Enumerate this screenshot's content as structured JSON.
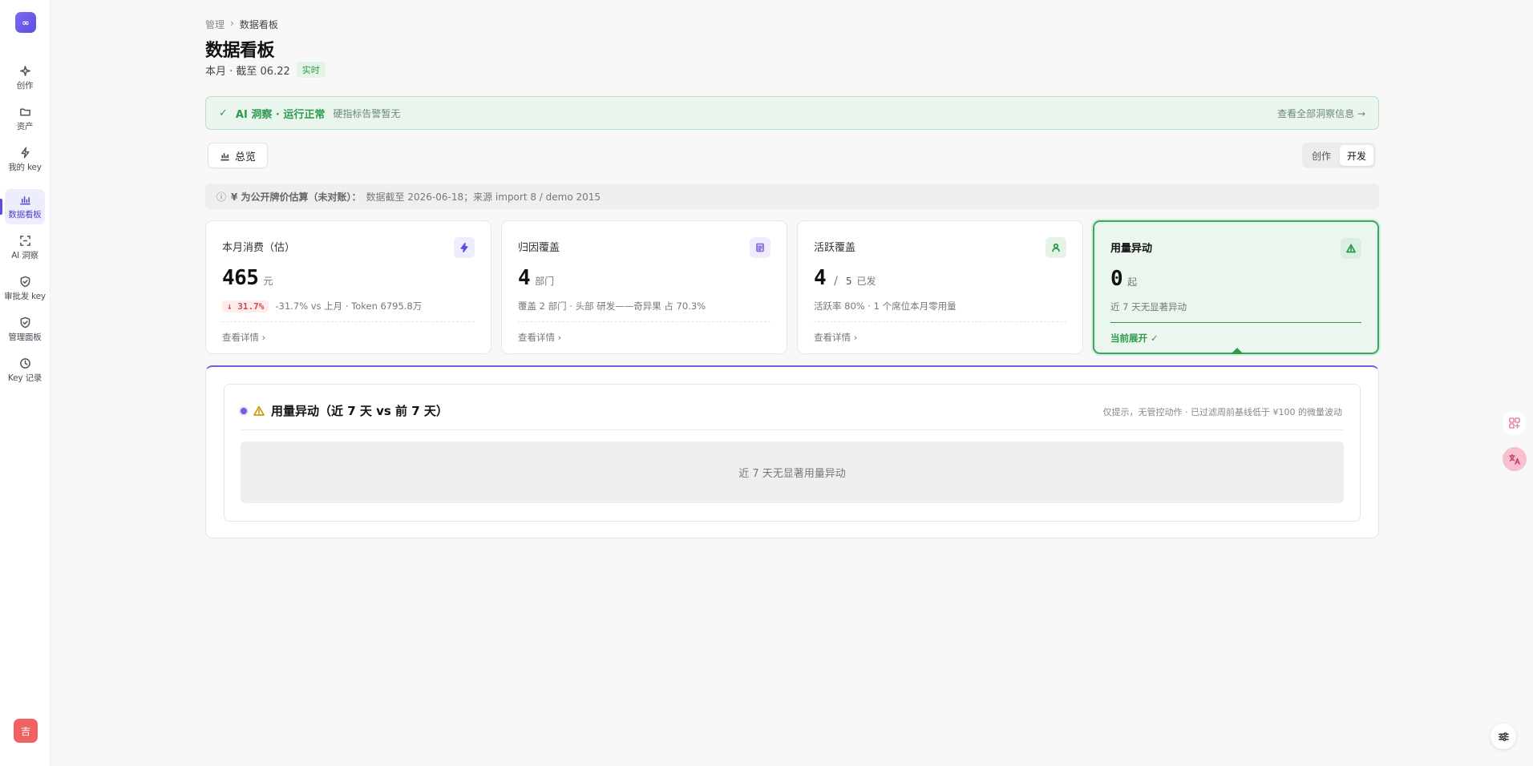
{
  "app": {
    "logo_text": "∞",
    "avatar_text": "吉"
  },
  "sidebar": {
    "items": [
      {
        "label": "创作",
        "icon": "sparkle-icon"
      },
      {
        "label": "资产",
        "icon": "folder-icon"
      },
      {
        "label": "我的 key",
        "icon": "lightning-icon"
      },
      {
        "label": "数据看板",
        "icon": "chart-icon",
        "active": true
      },
      {
        "label": "AI 洞察",
        "icon": "scan-icon"
      },
      {
        "label": "审批发 key",
        "icon": "shield-icon"
      },
      {
        "label": "管理面板",
        "icon": "shield-check-icon"
      },
      {
        "label": "Key 记录",
        "icon": "clock-icon"
      }
    ]
  },
  "breadcrumb": {
    "parent": "管理",
    "separator": "›",
    "current": "数据看板"
  },
  "header": {
    "title": "数据看板",
    "subtitle": "本月 · 截至 06.22",
    "live_badge": "实时"
  },
  "banner": {
    "title": "AI 洞察 · 运行正常",
    "desc": "硬指标告警暂无",
    "link": "查看全部洞察信息 →",
    "accent": "#2e9a4e"
  },
  "toolbar": {
    "overview_label": "总览",
    "segments": [
      "创作",
      "开发"
    ],
    "selected_segment": "开发"
  },
  "notice": {
    "strong": "¥ 为公开牌价估算（未对账）：",
    "text": "数据截至 2026-06-18；来源 import 8 / demo 2015"
  },
  "cards": [
    {
      "title": "本月消费（估）",
      "value": "465",
      "unit": "元",
      "change": "31.7%",
      "meta": "-31.7% vs 上月 · Token 6795.8万",
      "link": "查看详情 ›",
      "icon_color": "#5b4de0",
      "icon_bg": "#eeedfb"
    },
    {
      "title": "归因覆盖",
      "value": "4",
      "unit": "部门",
      "meta": "覆盖 2 部门 · 头部 研发——奇异果 占 70.3%",
      "link": "查看详情 ›",
      "icon_color": "#8a6fd6",
      "icon_bg": "#f1ecfb"
    },
    {
      "title": "活跃覆盖",
      "value": "4",
      "sep": "/",
      "value2": "5",
      "unit": "已发",
      "meta": "活跃率 80% · 1 个席位本月零用量",
      "link": "查看详情 ›",
      "icon_color": "#2e9a4e",
      "icon_bg": "#e4f5e8"
    },
    {
      "title": "用量异动",
      "value": "0",
      "unit": "起",
      "meta": "近 7 天无显著异动",
      "link": "当前展开 ✓",
      "icon_color": "#2e9a4e",
      "icon_bg": "#d9efdf"
    }
  ],
  "panel": {
    "title": "用量异动（近 7 天 vs 前 7 天）",
    "hint": "仅提示，无管控动作 · 已过滤周前基线低于 ¥100 的微量波动",
    "empty": "近 7 天无显著用量异动"
  }
}
